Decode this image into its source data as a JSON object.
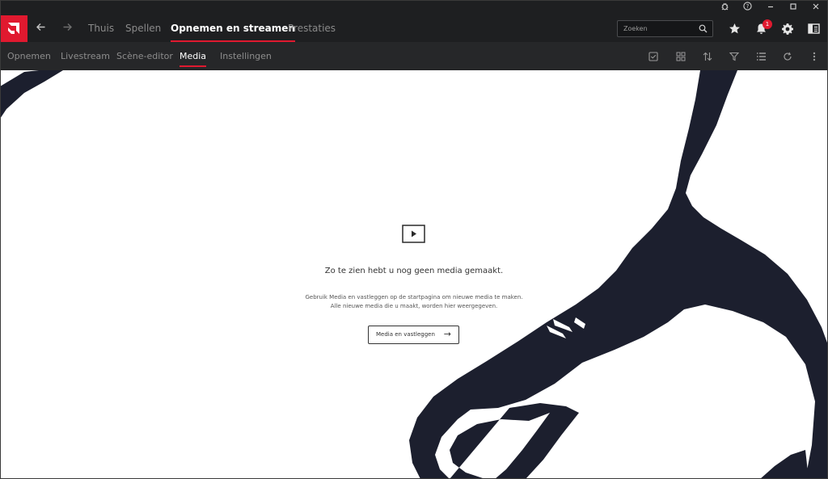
{
  "titlebar": {
    "icons": [
      "bug-icon",
      "help-icon",
      "minimize-icon",
      "maximize-icon",
      "close-icon"
    ]
  },
  "nav": {
    "back_icon": "arrow-left-icon",
    "forward_icon": "arrow-right-icon",
    "items": [
      {
        "label": "Thuis",
        "active": false
      },
      {
        "label": "Spellen",
        "active": false
      },
      {
        "label": "Opnemen en streamen",
        "active": true
      },
      {
        "label": "Prestaties",
        "active": false
      }
    ],
    "search_placeholder": "Zoeken",
    "notification_count": "1",
    "accent": "#e0192f"
  },
  "subnav": {
    "items": [
      {
        "label": "Opnemen",
        "active": false
      },
      {
        "label": "Livestream",
        "active": false
      },
      {
        "label": "Scène-editor",
        "active": false
      },
      {
        "label": "Media",
        "active": true
      },
      {
        "label": "Instellingen",
        "active": false
      }
    ],
    "tools": [
      "select-icon",
      "grid-view-icon",
      "sort-icon",
      "filter-icon",
      "list-view-icon",
      "refresh-icon",
      "more-icon"
    ]
  },
  "empty_state": {
    "icon": "play-screen-icon",
    "title": "Zo te zien hebt u nog geen media gemaakt.",
    "desc_line1": "Gebruik Media en vastleggen op de startpagina om nieuwe media te maken.",
    "desc_line2": "Alle nieuwe media die u maakt, worden hier weergegeven.",
    "button_label": "Media en vastleggen",
    "button_icon": "arrow-right-icon"
  },
  "colors": {
    "header_bg": "#1e1f21",
    "subnav_bg": "#262729",
    "wallpaper_ink": "#1c1f2e"
  }
}
